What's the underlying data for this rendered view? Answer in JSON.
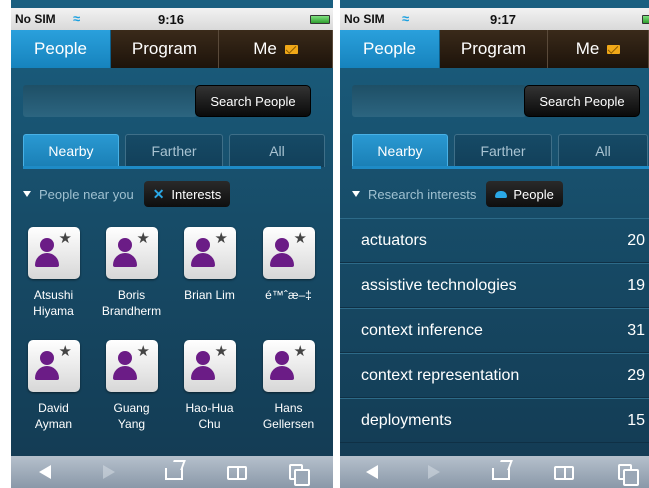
{
  "left": {
    "status": {
      "carrier": "No SIM",
      "time": "9:16"
    },
    "tabs": [
      {
        "label": "People",
        "active": true
      },
      {
        "label": "Program",
        "active": false
      },
      {
        "label": "Me",
        "active": false,
        "icon": "mail-icon"
      }
    ],
    "search": {
      "value": "",
      "button": "Search People"
    },
    "segments": [
      {
        "label": "Nearby",
        "active": true
      },
      {
        "label": "Farther",
        "active": false
      },
      {
        "label": "All",
        "active": false
      }
    ],
    "section": {
      "label": "People near you",
      "chip": "Interests",
      "chip_icon": "x-icon"
    },
    "people": [
      {
        "line1": "Atsushi",
        "line2": "Hiyama"
      },
      {
        "line1": "Boris",
        "line2": "Brandherm"
      },
      {
        "line1": "Brian Lim",
        "line2": ""
      },
      {
        "line1": "é™ˆæ–‡",
        "line2": ""
      },
      {
        "line1": "David",
        "line2": "Ayman"
      },
      {
        "line1": "Guang",
        "line2": "Yang"
      },
      {
        "line1": "Hao-Hua",
        "line2": "Chu"
      },
      {
        "line1": "Hans",
        "line2": "Gellersen"
      }
    ]
  },
  "right": {
    "status": {
      "carrier": "No SIM",
      "time": "9:17"
    },
    "tabs": [
      {
        "label": "People",
        "active": true
      },
      {
        "label": "Program",
        "active": false
      },
      {
        "label": "Me",
        "active": false,
        "icon": "mail-icon"
      }
    ],
    "search": {
      "value": "",
      "button": "Search People"
    },
    "segments": [
      {
        "label": "Nearby",
        "active": true
      },
      {
        "label": "Farther",
        "active": false
      },
      {
        "label": "All",
        "active": false
      }
    ],
    "section": {
      "label": "Research interests",
      "chip": "People",
      "chip_icon": "cloud-icon"
    },
    "interests": [
      {
        "name": "actuators",
        "count": "20"
      },
      {
        "name": "assistive technologies",
        "count": "19"
      },
      {
        "name": "context inference",
        "count": "31"
      },
      {
        "name": "context representation",
        "count": "29"
      },
      {
        "name": "deployments",
        "count": "15"
      }
    ]
  },
  "colors": {
    "accent": "#1a8ed0",
    "background": "#174c68",
    "avatar": "#6b1c86"
  }
}
